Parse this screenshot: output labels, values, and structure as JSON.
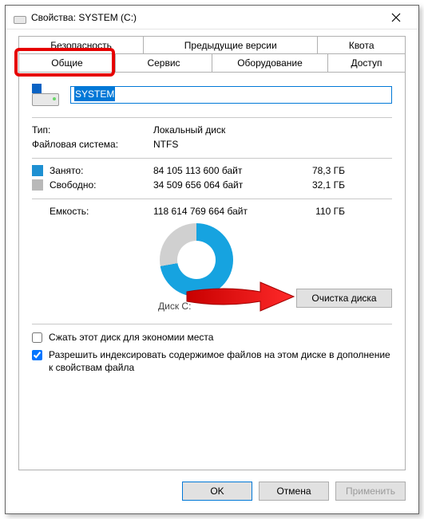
{
  "window": {
    "title": "Свойства: SYSTEM (C:)"
  },
  "tabs": {
    "back": [
      "Безопасность",
      "Предыдущие версии",
      "Квота"
    ],
    "front": [
      "Общие",
      "Сервис",
      "Оборудование",
      "Доступ"
    ],
    "active": "Общие"
  },
  "volume": {
    "name": "SYSTEM"
  },
  "info": {
    "type_label": "Тип:",
    "type_value": "Локальный диск",
    "fs_label": "Файловая система:",
    "fs_value": "NTFS"
  },
  "space": {
    "used_label": "Занято:",
    "used_bytes": "84 105 113 600 байт",
    "used_hr": "78,3 ГБ",
    "free_label": "Свободно:",
    "free_bytes": "34 509 656 064 байт",
    "free_hr": "32,1 ГБ",
    "cap_label": "Емкость:",
    "cap_bytes": "118 614 769 664 байт",
    "cap_hr": "110 ГБ"
  },
  "disk_label": "Диск C:",
  "cleanup_button": "Очистка диска",
  "options": {
    "compress": "Сжать этот диск для экономии места",
    "index": "Разрешить индексировать содержимое файлов на этом диске в дополнение к свойствам файла"
  },
  "buttons": {
    "ok": "OK",
    "cancel": "Отмена",
    "apply": "Применить"
  },
  "colors": {
    "used": "#1e90d2",
    "free": "#b9b9b9",
    "accent": "#0078d7",
    "annotation": "#e60000"
  },
  "chart_data": {
    "type": "pie",
    "title": "Диск C:",
    "series": [
      {
        "name": "Занято",
        "value": 84105113600,
        "value_hr": "78,3 ГБ",
        "color": "#16a3e0"
      },
      {
        "name": "Свободно",
        "value": 34509656064,
        "value_hr": "32,1 ГБ",
        "color": "#d0d0d0"
      }
    ],
    "total": {
      "name": "Емкость",
      "value": 118614769664,
      "value_hr": "110 ГБ"
    }
  }
}
